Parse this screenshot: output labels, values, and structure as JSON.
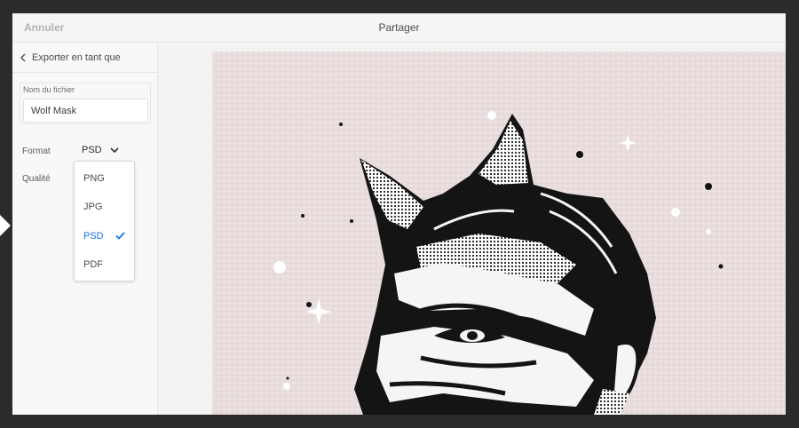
{
  "topbar": {
    "cancel_label": "Annuler",
    "title": "Partager"
  },
  "sidebar": {
    "back_label": "Exporter en tant que",
    "back_icon": "chevron-left-icon",
    "filename": {
      "label": "Nom du fichier",
      "value": "Wolf Mask"
    },
    "format": {
      "label": "Format",
      "value": "PSD",
      "icon": "chevron-down-icon"
    },
    "quality": {
      "label": "Qualité"
    },
    "dropdown": {
      "options": [
        "PNG",
        "JPG",
        "PSD",
        "PDF"
      ],
      "selected": "PSD",
      "check_icon": "checkmark-icon"
    }
  },
  "canvas": {
    "subject": "wolf-mask-illustration",
    "background_color": "#e8dcdc"
  },
  "colors": {
    "accent": "#1473e6",
    "outer_frame": "#2b2b2b"
  }
}
